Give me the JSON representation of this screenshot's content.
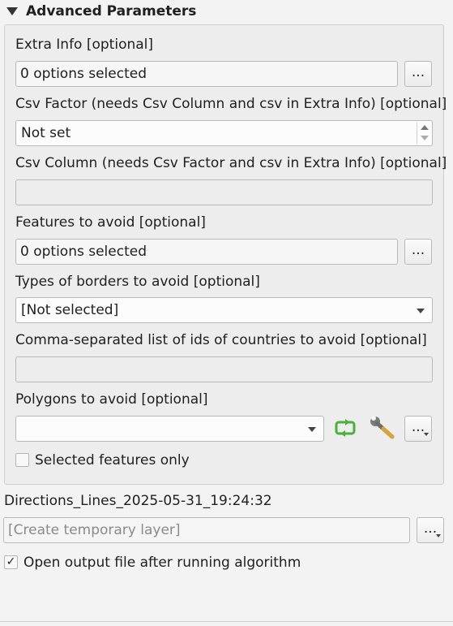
{
  "section": {
    "title": "Advanced Parameters",
    "collapse_icon": "triangle-down-icon"
  },
  "extra_info": {
    "label": "Extra Info [optional]",
    "value": "0 options selected",
    "browse_label": "..."
  },
  "csv_factor": {
    "label": "Csv Factor (needs Csv Column and csv in Extra Info) [optional]",
    "value": "Not set"
  },
  "csv_column": {
    "label": "Csv Column (needs Csv Factor and csv in Extra Info) [optional]",
    "value": ""
  },
  "features_to_avoid": {
    "label": "Features to avoid [optional]",
    "value": "0 options selected",
    "browse_label": "..."
  },
  "borders_to_avoid": {
    "label": "Types of borders to avoid [optional]",
    "value": "[Not selected]"
  },
  "countries_to_avoid": {
    "label": "Comma-separated list of ids of countries to avoid [optional]",
    "value": ""
  },
  "polygons_to_avoid": {
    "label": "Polygons to avoid [optional]",
    "value": "",
    "iterate_icon": "iterate-refresh-icon",
    "settings_icon": "wrench-icon",
    "more_label": "...",
    "selected_only_label": "Selected features only",
    "selected_only_checked": false
  },
  "output": {
    "label": "Directions_Lines_2025-05-31_19:24:32",
    "placeholder": "[Create temporary layer]",
    "more_label": "...",
    "open_after_label": "Open output file after running algorithm",
    "open_after_checked": true
  },
  "colors": {
    "iterate_green": "#4caf3c",
    "wrench_grey": "#6d6d6d",
    "wrench_handle": "#d9a53a"
  }
}
